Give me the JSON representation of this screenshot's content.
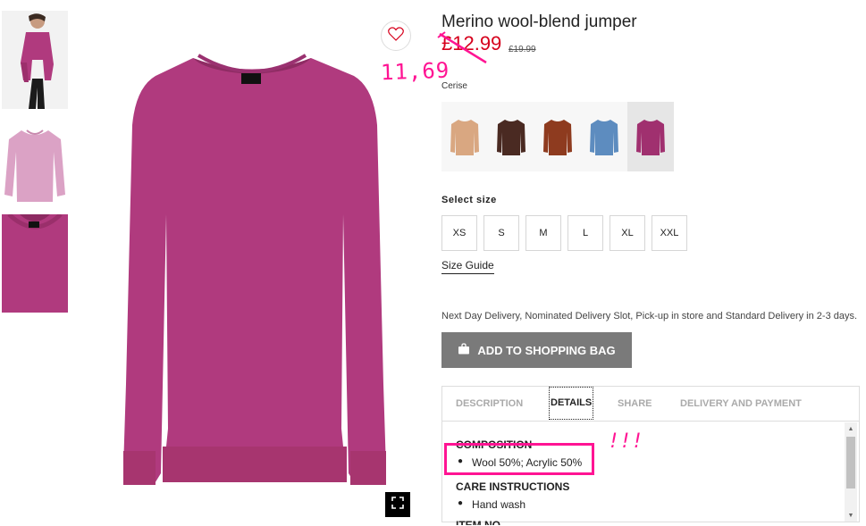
{
  "product": {
    "title": "Merino wool-blend jumper",
    "sale_price": "£12.99",
    "old_price": "£19.99",
    "color_name": "Cerise",
    "handwritten_price": "11,69"
  },
  "colors": {
    "accent_pink": "#ff1493",
    "sale_red": "#d6001c",
    "jumper_cerise": "#b03a7e"
  },
  "swatches": [
    {
      "name": "Beige",
      "color": "#d9a781"
    },
    {
      "name": "Dark brown",
      "color": "#4a2a22"
    },
    {
      "name": "Rust",
      "color": "#8e3b1f"
    },
    {
      "name": "Blue",
      "color": "#5d8cbf"
    },
    {
      "name": "Cerise",
      "color": "#a0306f",
      "selected": true
    }
  ],
  "sizes": {
    "label": "Select size",
    "options": [
      "XS",
      "S",
      "M",
      "L",
      "XL",
      "XXL"
    ],
    "guide_label": "Size Guide"
  },
  "delivery_note": "Next Day Delivery, Nominated Delivery Slot, Pick-up in store and Standard Delivery in 2-3 days.",
  "add_to_bag_label": "ADD TO SHOPPING BAG",
  "tabs": [
    "DESCRIPTION",
    "DETAILS",
    "SHARE",
    "DELIVERY AND PAYMENT"
  ],
  "details": {
    "composition_heading": "COMPOSITION",
    "composition": "Wool 50%; Acrylic 50%",
    "care_heading": "CARE INSTRUCTIONS",
    "care": "Hand wash",
    "next_heading": "ITEM NO"
  },
  "annotation": {
    "exclaim": "!!!"
  },
  "icons": {
    "favourite": "heart-icon",
    "expand": "fullscreen-icon",
    "bag": "shopping-bag-icon"
  }
}
